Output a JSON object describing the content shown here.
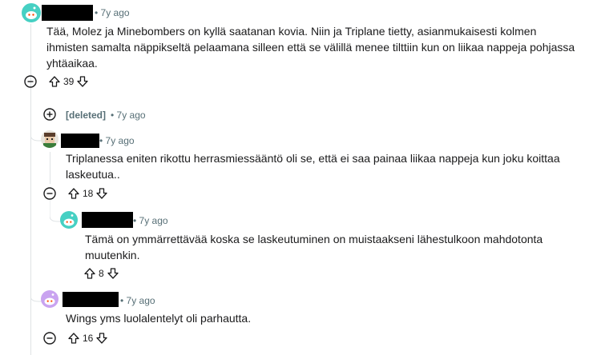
{
  "comments": [
    {
      "author": "",
      "time": "• 7y ago",
      "body": "Tää, Molez ja Minebombers on kyllä saatanan kovia. Niin ja Triplane tietty, asianmukaisesti kolmen ihmisten samalta näppikseltä pelaamana silleen että se välillä menee tilttiin kun on liikaa nappeja pohjassa yhtäaikaa.",
      "votes": "39",
      "avatar_color": "#46d0c3"
    },
    {
      "author": "[deleted]",
      "time": "• 7y ago"
    },
    {
      "author": "",
      "time": "• 7y ago",
      "body": "Triplanessa eniten rikottu herrasmiessääntö oli se, että ei saa painaa liikaa nappeja kun joku koittaa laskeutua..",
      "votes": "18"
    },
    {
      "author": "",
      "time": "• 7y ago",
      "body": "Tämä on ymmärrettävää koska se laskeutuminen on muistaakseni lähestulkoon mahdotonta muutenkin.",
      "votes": "8",
      "avatar_color": "#46d0c3"
    },
    {
      "author": "",
      "time": "• 7y ago",
      "body": "Wings yms luolalentelyt oli parhautta.",
      "votes": "16",
      "avatar_color": "#c9a3f0"
    }
  ],
  "colors": {
    "thread_line": "#dfe3e5",
    "meta_text": "#576f76"
  }
}
